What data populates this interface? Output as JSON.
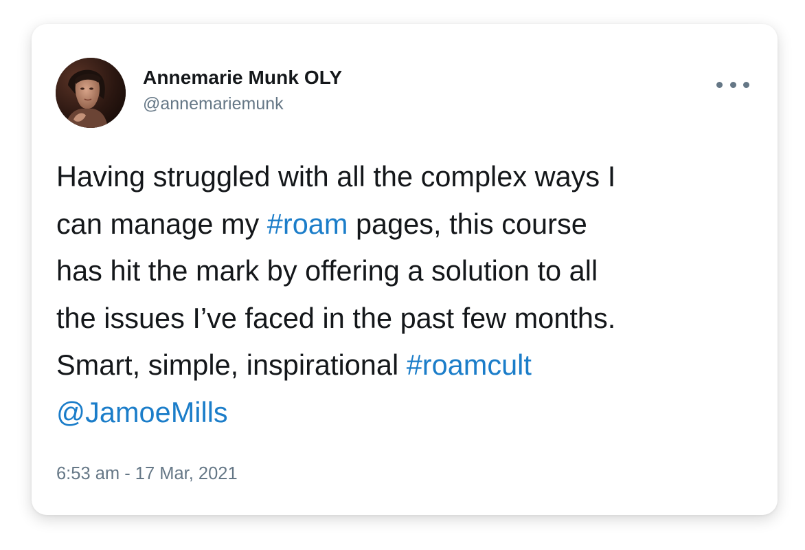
{
  "tweet": {
    "author": {
      "name": "Annemarie Munk OLY",
      "handle": "@annemariemunk",
      "avatar_icon": "user-avatar-photo"
    },
    "more_icon": "more-options-icon",
    "text_lines": [
      {
        "before": "Having struggled with all the complex ways I"
      },
      {
        "before": "can manage my ",
        "link": "#roam",
        "after": " pages, this course"
      },
      {
        "before": "has hit the mark by offering a solution to all"
      },
      {
        "before": "the issues I’ve faced in the past few months."
      },
      {
        "before": "Smart, simple, inspirational ",
        "link": "#roamcult"
      },
      {
        "link": "@JamoeMills"
      }
    ],
    "timestamp": "6:53 am - 17 Mar, 2021",
    "colors": {
      "link": "#1b7dc9",
      "text": "#14171a",
      "secondary": "#657786"
    }
  }
}
